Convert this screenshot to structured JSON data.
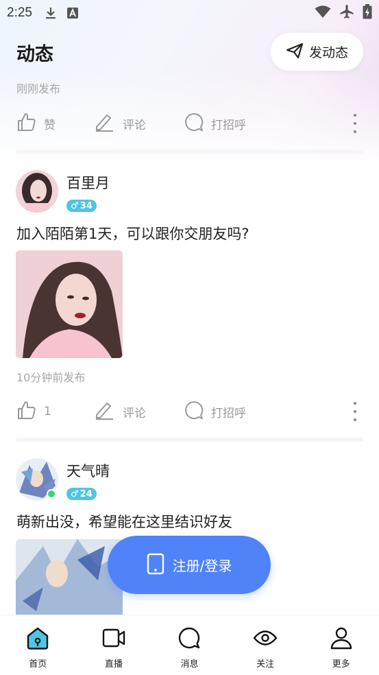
{
  "status_bar": {
    "time": "2:25"
  },
  "header": {
    "title": "动态",
    "post_button_label": "发动态"
  },
  "post_top": {
    "time": "刚刚发布",
    "like_label": "赞",
    "comment_label": "评论",
    "greet_label": "打招呼"
  },
  "post_1": {
    "username": "百里月",
    "gender_symbol": "♂",
    "age": "34",
    "text": "加入陌陌第1天，可以跟你交朋友吗?",
    "time": "10分钟前发布",
    "like_count": "1",
    "comment_label": "评论",
    "greet_label": "打招呼"
  },
  "post_2": {
    "username": "天气晴",
    "gender_symbol": "♂",
    "age": "24",
    "text": "萌新出没，希望能在这里结识好友"
  },
  "login_button": {
    "label": "注册/登录"
  },
  "bottom_nav": [
    {
      "label": "首页",
      "icon": "home-icon",
      "active": true
    },
    {
      "label": "直播",
      "icon": "video-icon"
    },
    {
      "label": "消息",
      "icon": "message-icon"
    },
    {
      "label": "关注",
      "icon": "eye-icon"
    },
    {
      "label": "更多",
      "icon": "person-icon"
    }
  ],
  "colors": {
    "accent": "#4f83f7",
    "badge": "#4ec5e4",
    "online": "#3dd47a",
    "nav_active": "#4ec5e4"
  }
}
